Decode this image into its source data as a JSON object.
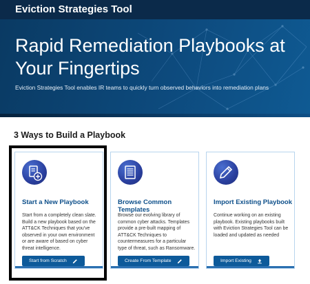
{
  "header": {
    "app_title": "Eviction Strategies Tool"
  },
  "hero": {
    "title": "Rapid Remediation Playbooks at Your Fingertips",
    "subtitle": "Eviction Strategies Tool enables IR teams to quickly turn observed behaviors into remediation plans"
  },
  "section": {
    "title": "3 Ways to Build a Playbook"
  },
  "cards": [
    {
      "title": "Start a New Playbook",
      "text": "Start from a completely clean slate. Build a new playbook based on the ATT&CK Techniques that you've observed in your own environment or are aware of based on cyber threat intelligence.",
      "button": "Start from Scratch",
      "icon": "document-add-icon",
      "button_icon": "pencil-icon"
    },
    {
      "title": "Browse Common Templates",
      "text": "Browse our evolving library of common cyber attacks. Templates provide a pre-built mapping of ATT&CK Techniques to countermeasures for a particular type of threat, such as Ransomware.",
      "button": "Create From Template",
      "icon": "template-document-icon",
      "button_icon": "pencil-icon"
    },
    {
      "title": "Import Existing Playbook",
      "text": "Continue working on an existing playbook. Existing playbooks built with Eviction Strategies Tool can be loaded and updated as needed",
      "button": "Import Existing",
      "icon": "pencil-icon",
      "button_icon": "upload-icon"
    }
  ],
  "colors": {
    "header_bg": "#0b2a4a",
    "hero_bg": "#0d4a7d",
    "accent": "#0d5a9a",
    "card_title": "#0d4f8a",
    "card_border": "#b7d4ee",
    "highlight_border": "#000000"
  }
}
